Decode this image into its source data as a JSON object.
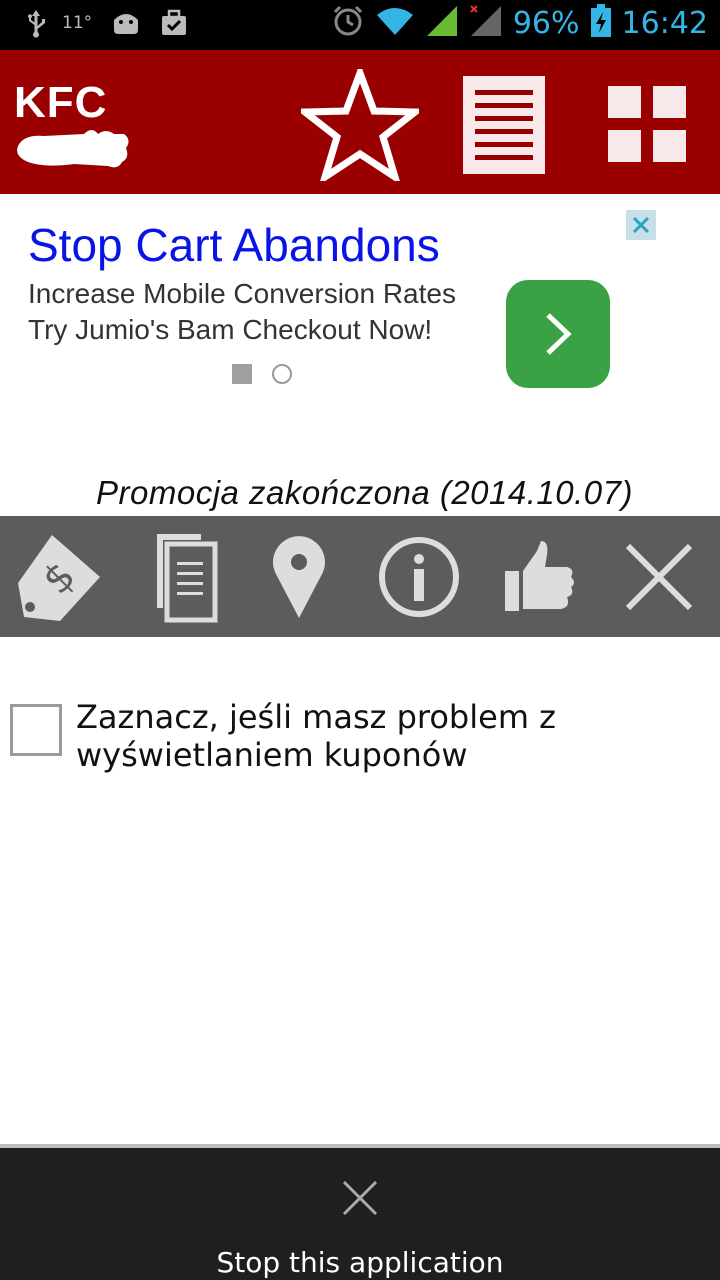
{
  "status_bar": {
    "temperature": "11°",
    "battery_percent": "96%",
    "time": "16:42",
    "icons": [
      "usb-icon",
      "android-icon",
      "briefcase-icon",
      "alarm-icon",
      "wifi-icon",
      "signal-icon",
      "signal-icon-2",
      "battery-charging-icon"
    ],
    "accent_color": "#33b5e5"
  },
  "header": {
    "logo_text": "KFC",
    "background_color": "#9b0000",
    "buttons": [
      "star-icon",
      "list-icon",
      "grid-icon"
    ]
  },
  "ad": {
    "title": "Stop Cart Abandons",
    "line1": "Increase Mobile Conversion Rates",
    "line2": "Try Jumio's Bam Checkout Now!",
    "button_color": "#3aa245",
    "title_color": "#0a14e6",
    "page_indicator": {
      "current": 1,
      "total": 2
    }
  },
  "promo_status": "Promocja zakończona (2014.10.07)",
  "toolbar": {
    "background_color": "#5c5c5c",
    "icons": [
      "price-tag-icon",
      "copy-icon",
      "location-pin-icon",
      "info-icon",
      "thumbs-up-icon",
      "close-icon"
    ]
  },
  "checkbox": {
    "label": "Zaznacz, jeśli masz problem z wyświetlaniem kuponów",
    "checked": false
  },
  "bottom_panel": {
    "stop_label": "Stop this application"
  }
}
